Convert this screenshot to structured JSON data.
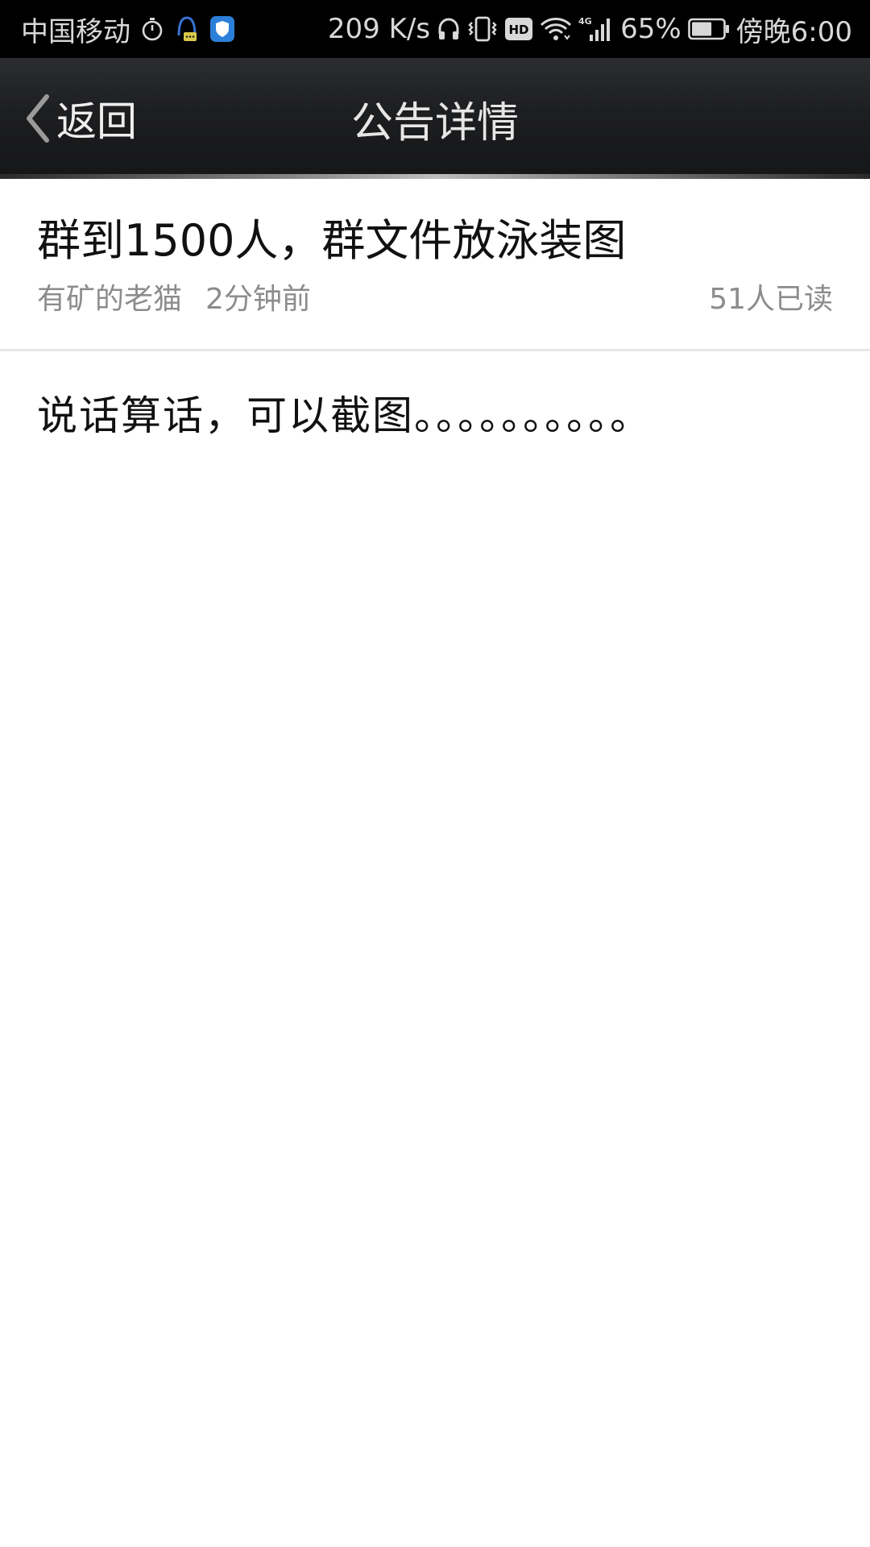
{
  "status_bar": {
    "carrier": "中国移动",
    "net_speed": "209 K/s",
    "hd_badge": "HD",
    "network_type": "4G",
    "battery_percent": "65%",
    "battery_level": 0.65,
    "time": "傍晚6:00",
    "icons": [
      "stopwatch-icon",
      "qq-assistant-icon",
      "shield-icon",
      "headphones-icon",
      "vibrate-icon",
      "hd-icon",
      "wifi-icon",
      "signal-icon",
      "battery-icon"
    ]
  },
  "header": {
    "back_label": "返回",
    "title": "公告详情"
  },
  "announcement": {
    "title": "群到1500人，群文件放泳装图",
    "author": "有矿的老猫",
    "time": "2分钟前",
    "read_count": "51人已读",
    "body": "说话算话，可以截图。。。。。。。。。。"
  },
  "colors": {
    "status_bar_bg": "#000000",
    "title_bar_bg": "#1d1e20",
    "page_bg": "#ffffff",
    "meta_text": "#8c8c8c",
    "primary_text": "#111111",
    "shield_blue": "#2b7fd8"
  }
}
